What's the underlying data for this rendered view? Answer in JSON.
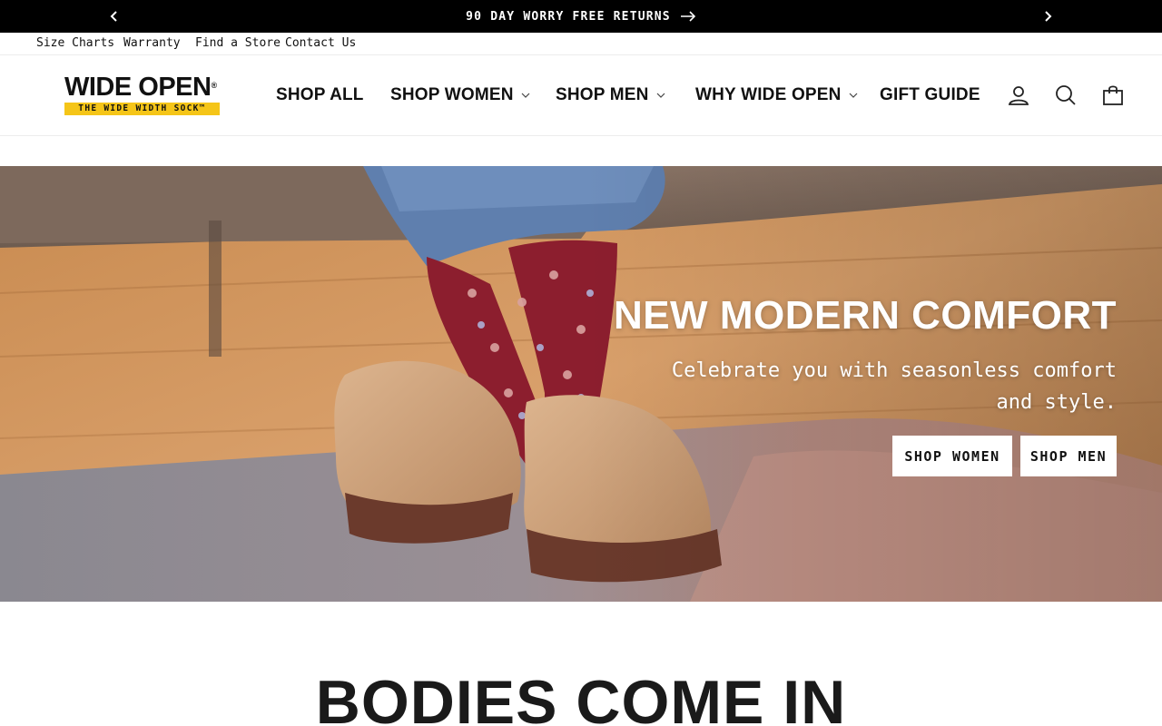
{
  "announcement": {
    "message": "90 DAY WORRY FREE RETURNS",
    "prev_icon": "chevron-left-icon",
    "next_icon": "chevron-right-icon",
    "arrow_icon": "arrow-right-icon"
  },
  "utility_links": [
    {
      "label": "Size Charts"
    },
    {
      "label": "Warranty"
    },
    {
      "label": "Find a Store"
    },
    {
      "label": "Contact Us"
    }
  ],
  "logo": {
    "wordmark": "WIDE OPEN",
    "registered": "®",
    "tagline": "THE WIDE WIDTH SOCK",
    "tagline_mark": "™",
    "tag_color": "#f5c518"
  },
  "nav": [
    {
      "label": "SHOP ALL",
      "has_dropdown": false
    },
    {
      "label": "SHOP WOMEN",
      "has_dropdown": true
    },
    {
      "label": "SHOP MEN",
      "has_dropdown": true
    },
    {
      "label": "WHY WIDE OPEN",
      "has_dropdown": true
    },
    {
      "label": "GIFT GUIDE",
      "has_dropdown": false
    }
  ],
  "header_icons": [
    "account-icon",
    "search-icon",
    "cart-icon"
  ],
  "hero": {
    "title": "NEW MODERN COMFORT",
    "subtitle": "Celebrate you with seasonless comfort and style.",
    "buttons": [
      {
        "label": "SHOP WOMEN"
      },
      {
        "label": "SHOP MEN"
      }
    ]
  },
  "section": {
    "title": "BODIES COME IN"
  },
  "colors": {
    "announcement_bg": "#000000",
    "text": "#111111",
    "sock": "#8c1e2e",
    "clog": "#cfa37a",
    "sole": "#6b3a2c"
  }
}
